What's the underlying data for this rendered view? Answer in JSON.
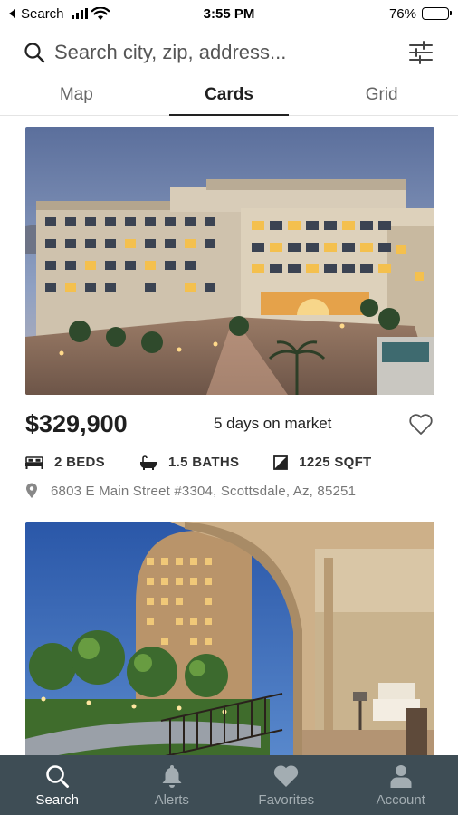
{
  "status_bar": {
    "back_label": "Search",
    "time": "3:55 PM",
    "battery_percent": "76%",
    "battery_level": 0.76
  },
  "search": {
    "placeholder": "Search city, zip, address..."
  },
  "tabs": [
    {
      "label": "Map",
      "active": false
    },
    {
      "label": "Cards",
      "active": true
    },
    {
      "label": "Grid",
      "active": false
    }
  ],
  "listings": [
    {
      "price": "$329,900",
      "days_on_market": "5 days on market",
      "beds": "2 BEDS",
      "baths": "1.5 BATHS",
      "sqft": "1225 SQFT",
      "address": "6803 E Main Street #3304, Scottsdale, Az, 85251",
      "photo": "condo-complex-courtyard-at-dusk"
    },
    {
      "photo": "arched-balcony-overlooking-tower-and-garden"
    }
  ],
  "bottom_nav": [
    {
      "label": "Search",
      "icon": "search-icon",
      "active": true
    },
    {
      "label": "Alerts",
      "icon": "bell-icon",
      "active": false
    },
    {
      "label": "Favorites",
      "icon": "heart-icon",
      "active": false
    },
    {
      "label": "Account",
      "icon": "person-icon",
      "active": false
    }
  ],
  "colors": {
    "nav_background": "#3e4d55",
    "nav_active": "#ffffff",
    "nav_inactive": "#a3adb2"
  }
}
